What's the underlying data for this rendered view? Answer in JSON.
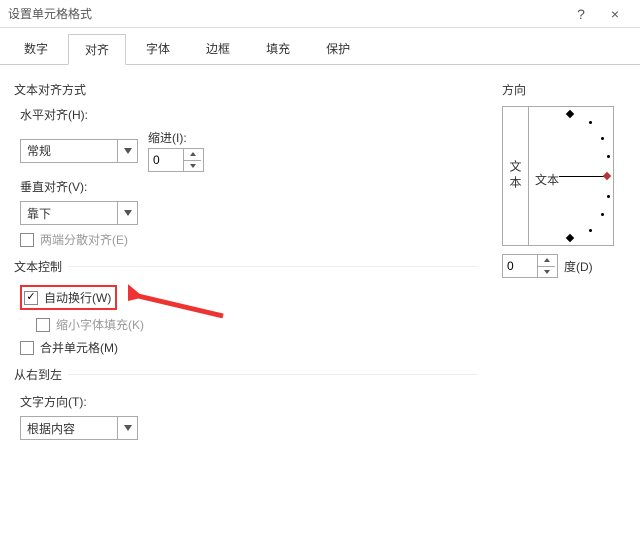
{
  "window": {
    "title": "设置单元格格式",
    "help": "?",
    "close": "×"
  },
  "tabs": {
    "items": [
      "数字",
      "对齐",
      "字体",
      "边框",
      "填充",
      "保护"
    ],
    "active": 1
  },
  "align": {
    "section": "文本对齐方式",
    "h_label": "水平对齐(H):",
    "h_value": "常规",
    "v_label": "垂直对齐(V):",
    "v_value": "靠下",
    "indent_label": "缩进(I):",
    "indent_value": "0",
    "justify_label": "两端分散对齐(E)"
  },
  "textctrl": {
    "section": "文本控制",
    "wrap_label": "自动换行(W)",
    "shrink_label": "缩小字体填充(K)",
    "merge_label": "合并单元格(M)"
  },
  "rtl": {
    "section": "从右到左",
    "dir_label": "文字方向(T):",
    "dir_value": "根据内容"
  },
  "orient": {
    "section": "方向",
    "vtext": "文本",
    "label": "文本",
    "deg_value": "0",
    "deg_label": "度(D)"
  }
}
